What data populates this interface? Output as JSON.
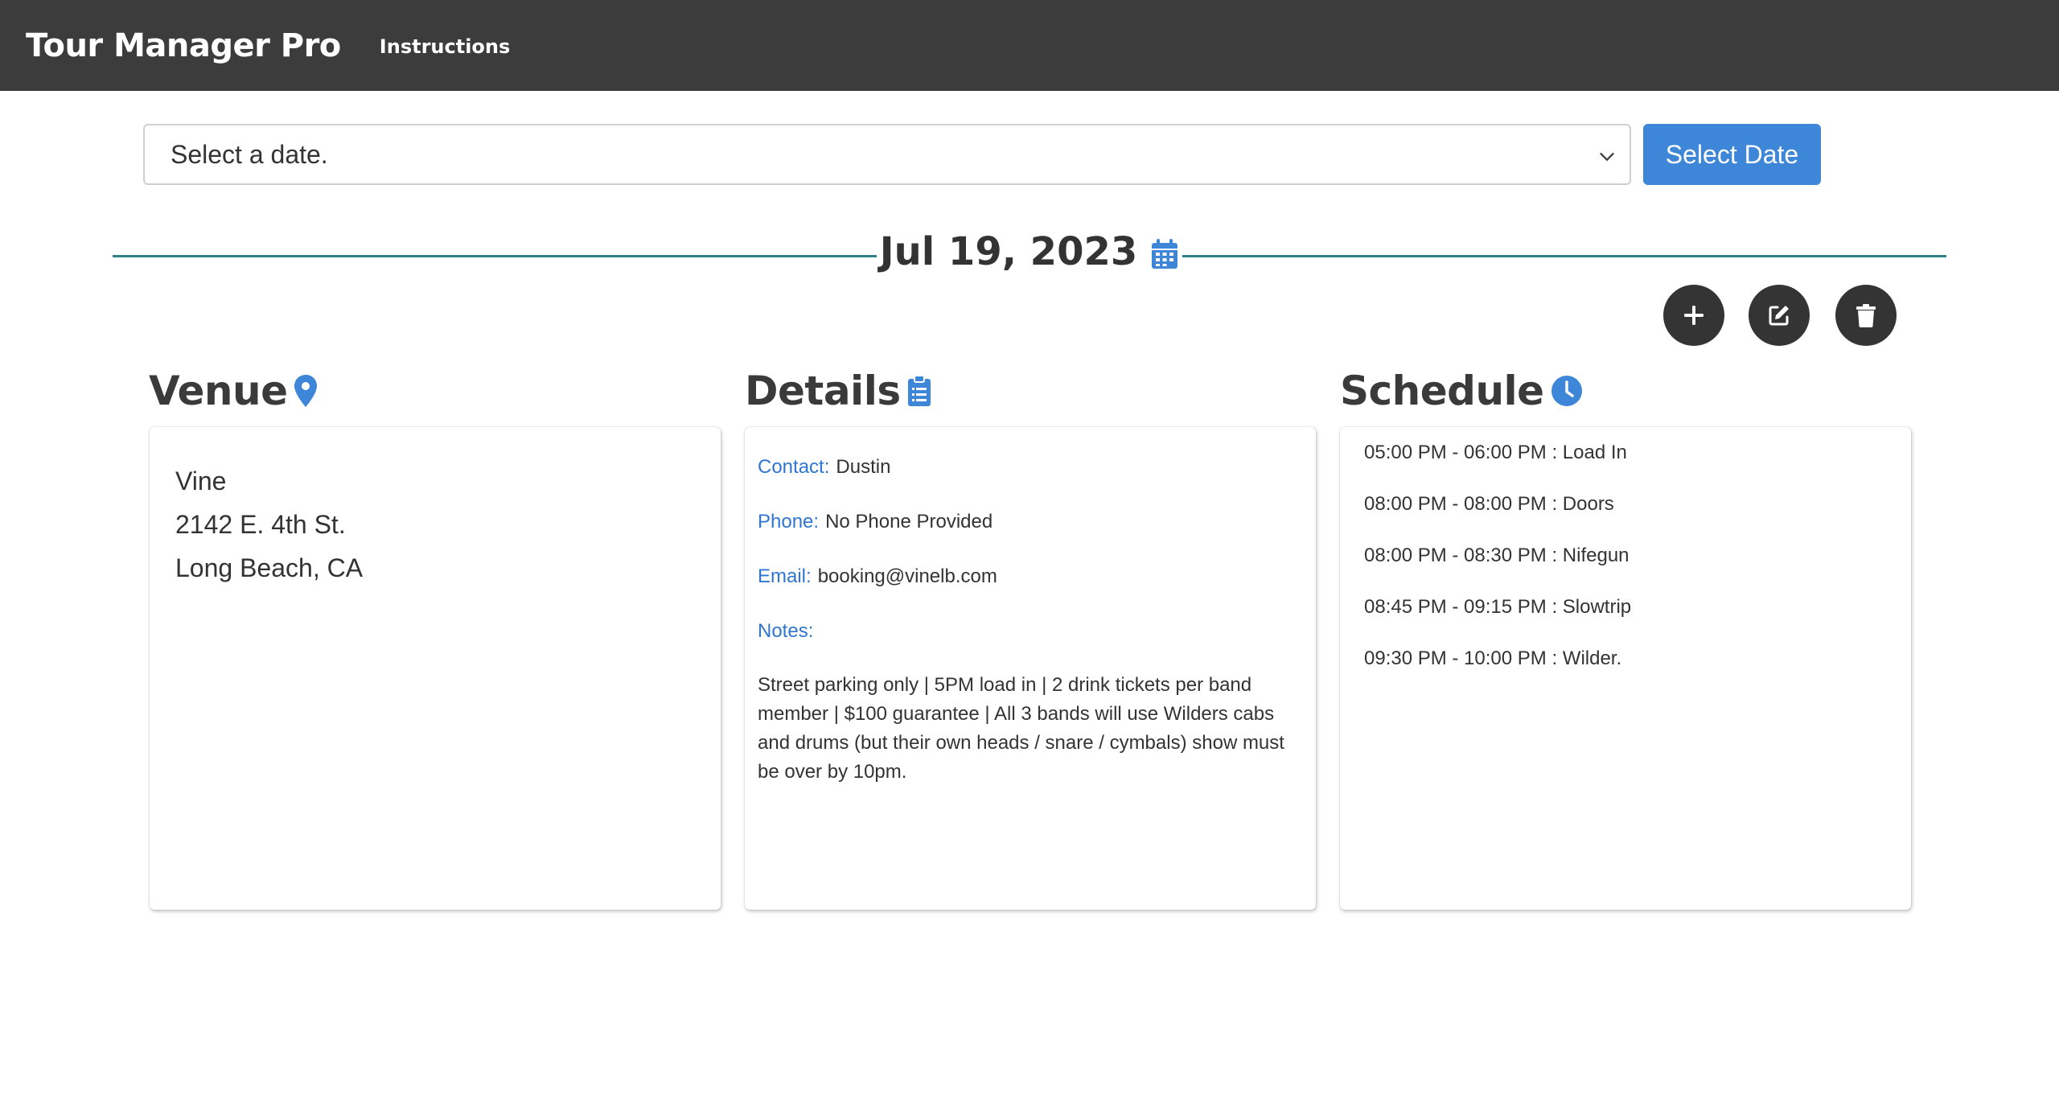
{
  "navbar": {
    "brand": "Tour Manager Pro",
    "link_instructions": "Instructions"
  },
  "date_picker": {
    "selected_text": "Select a date.",
    "button_label": "Select Date"
  },
  "current_date": "Jul 19, 2023",
  "actions": {
    "add_icon": "plus-icon",
    "edit_icon": "edit-icon",
    "delete_icon": "trash-icon"
  },
  "venue": {
    "title": "Venue",
    "icon": "map-pin-icon",
    "name": "Vine",
    "street": "2142 E. 4th St.",
    "city": "Long Beach, CA"
  },
  "details": {
    "title": "Details",
    "icon": "clipboard-icon",
    "contact_label": "Contact:",
    "contact_value": "Dustin",
    "phone_label": "Phone:",
    "phone_value": "No Phone Provided",
    "email_label": "Email:",
    "email_value": "booking@vinelb.com",
    "notes_label": "Notes:",
    "notes_value": "Street parking only | 5PM load in | 2 drink tickets per band member | $100 guarantee | All 3 bands will use Wilders cabs and drums (but their own heads / snare / cymbals) show must be over by 10pm."
  },
  "schedule": {
    "title": "Schedule",
    "icon": "clock-icon",
    "items": [
      "05:00 PM - 06:00 PM : Load In",
      "08:00 PM - 08:00 PM : Doors",
      "08:00 PM - 08:30 PM : Nifegun",
      "08:45 PM - 09:15 PM : Slowtrip",
      "09:30 PM - 10:00 PM : Wilder."
    ]
  },
  "colors": {
    "navbar": "#3c3c3c",
    "accent_blue": "#3d86d8",
    "label_blue": "#2f76d2",
    "rule_teal": "#2f7f86",
    "round_button": "#343434"
  }
}
